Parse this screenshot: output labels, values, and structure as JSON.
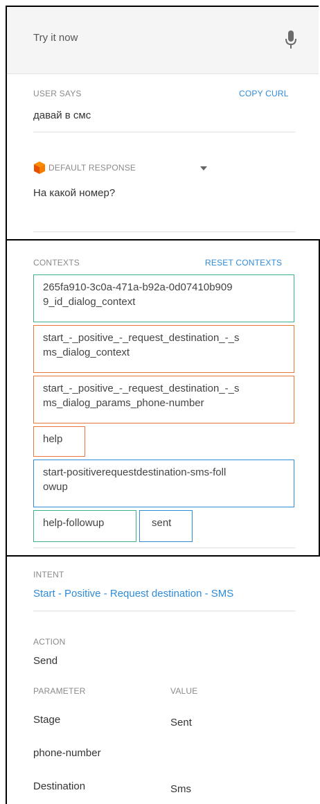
{
  "try_it": {
    "placeholder": "Try it now",
    "mic_icon": "microphone-icon"
  },
  "user_says": {
    "label": "USER SAYS",
    "copy_curl": "COPY CURL",
    "text": "давай в смс"
  },
  "default_response": {
    "label": "DEFAULT RESPONSE",
    "icon": "cube-icon",
    "text": "На какой номер?"
  },
  "contexts": {
    "label": "CONTEXTS",
    "reset": "RESET CONTEXTS",
    "items": [
      {
        "line1": "265fa910-3c0a-471a-b92a-0d07410b909",
        "line2": "9_id_dialog_context",
        "color": "#3bb08f"
      },
      {
        "line1": "start_-_positive_-_request_destination_-_s",
        "line2": "ms_dialog_context",
        "color": "#e8763a"
      },
      {
        "line1": "start_-_positive_-_request_destination_-_s",
        "line2": "ms_dialog_params_phone-number",
        "color": "#e8763a"
      },
      {
        "line1": "help",
        "line2": "",
        "color": "#e8763a"
      },
      {
        "line1": "start-positiverequestdestination-sms-foll",
        "line2": "owup",
        "color": "#2e8bd8"
      },
      {
        "line1": "help-followup",
        "line2": "",
        "color": "#3bb08f"
      },
      {
        "line1": "sent",
        "line2": "",
        "color": "#2e8bd8"
      }
    ]
  },
  "intent": {
    "label": "INTENT",
    "value": "Start - Positive - Request destination - SMS"
  },
  "action": {
    "label": "ACTION",
    "value": "Send"
  },
  "parameters": {
    "param_header": "PARAMETER",
    "value_header": "VALUE",
    "rows": [
      {
        "name": "Stage",
        "value": "Sent"
      },
      {
        "name": "phone-number",
        "value": ""
      },
      {
        "name": "Destination",
        "value": "Sms"
      }
    ]
  },
  "colors": {
    "link": "#2e8bd8",
    "context_green": "#3bb08f",
    "context_orange": "#e8763a",
    "context_blue": "#2e8bd8",
    "response_icon": "#f57c00"
  }
}
